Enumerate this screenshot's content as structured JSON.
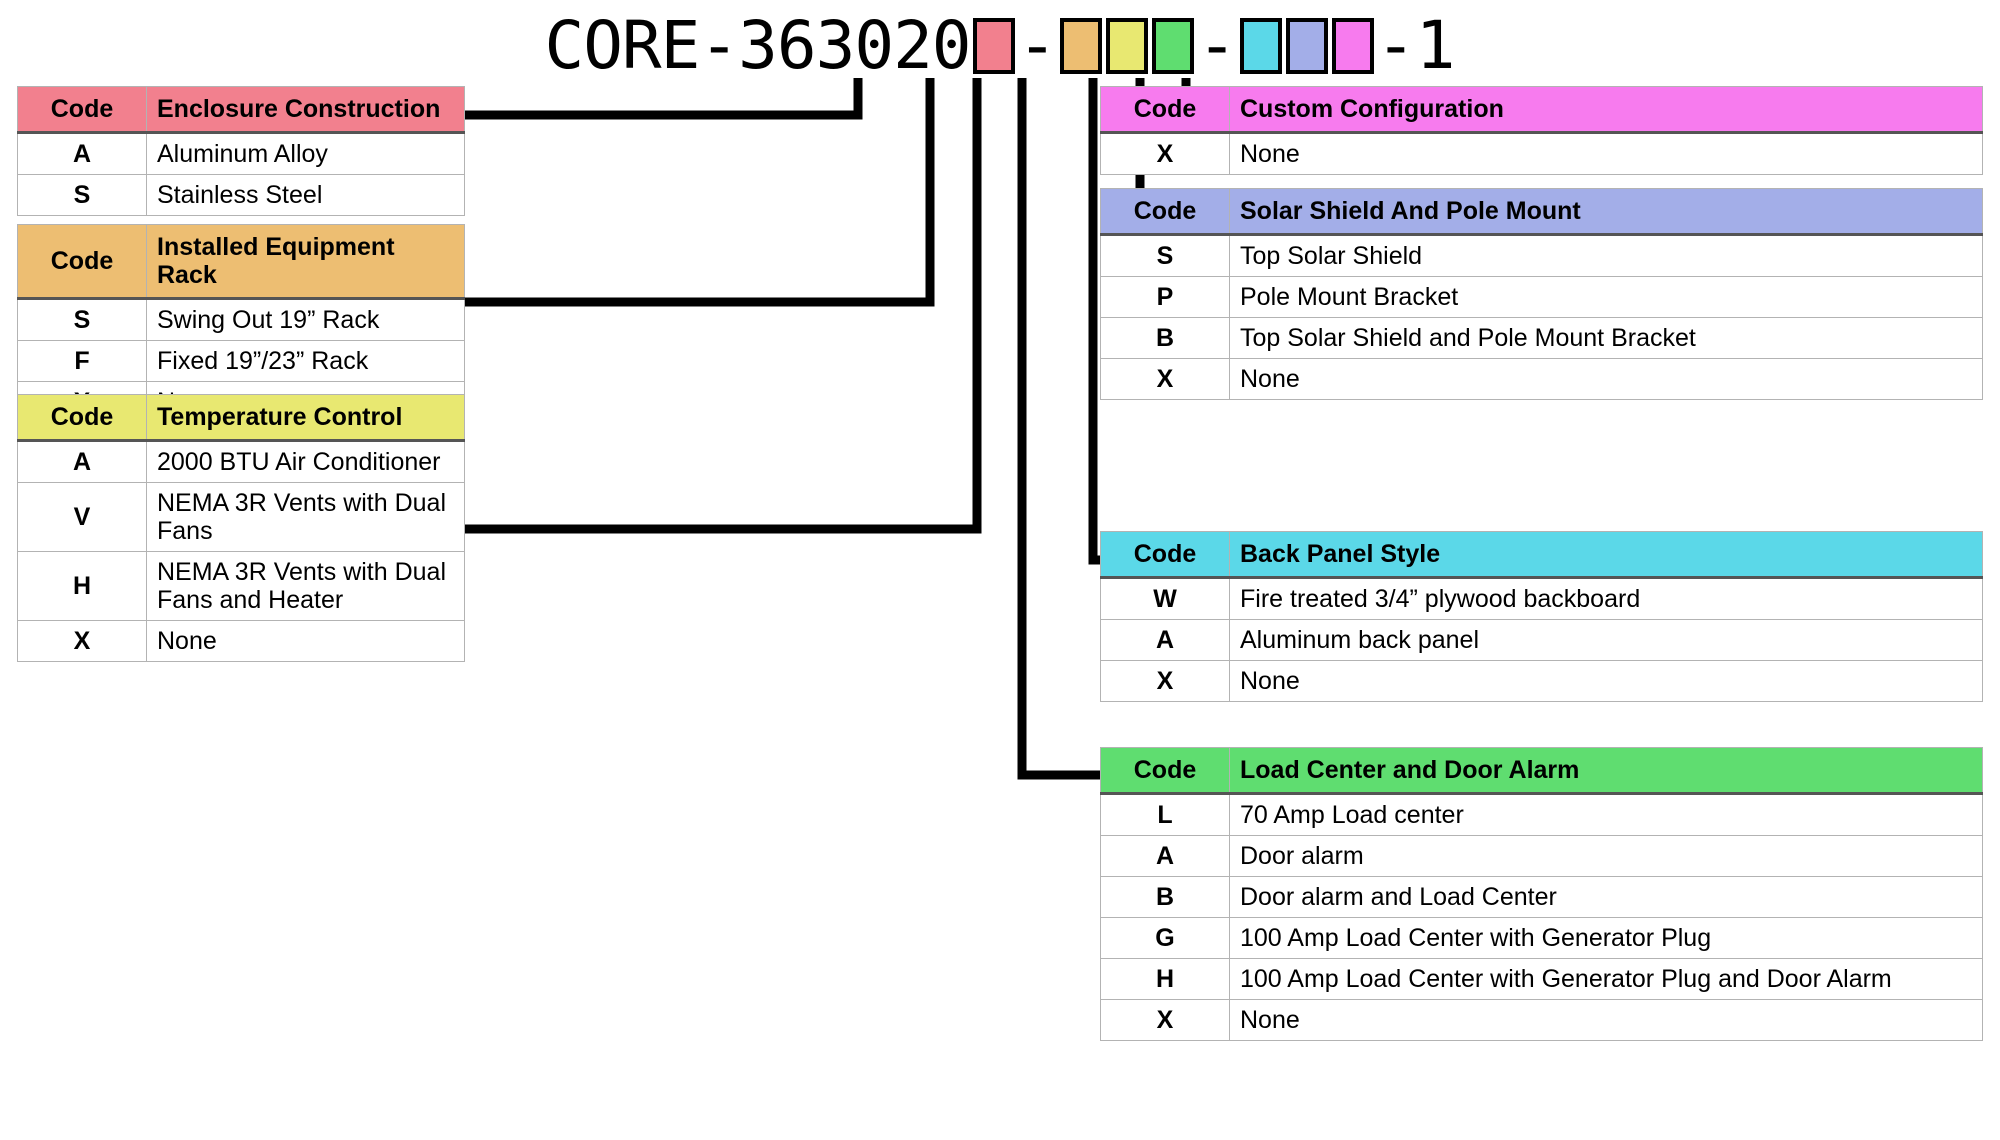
{
  "part_number": {
    "prefix": "CORE-363020",
    "suffix": "-1",
    "dash1": "-",
    "dash2": "-",
    "segments": [
      {
        "name": "enclosure-construction",
        "color": "#F2808E"
      },
      {
        "name": "installed-equipment-rack",
        "color": "#EDBE72"
      },
      {
        "name": "temperature-control",
        "color": "#E8E871"
      },
      {
        "name": "load-center-and-door-alarm",
        "color": "#5FDD70"
      },
      {
        "name": "back-panel-style",
        "color": "#5BD8E8"
      },
      {
        "name": "solar-shield-and-pole-mount",
        "color": "#A3AEE8"
      },
      {
        "name": "custom-configuration",
        "color": "#F77BEE"
      }
    ]
  },
  "code_header": "Code",
  "tables": {
    "enclosure": {
      "title": "Enclosure Construction",
      "color": "#F2808E",
      "rows": [
        {
          "code": "A",
          "desc": "Aluminum Alloy"
        },
        {
          "code": "S",
          "desc": "Stainless Steel"
        }
      ]
    },
    "rack": {
      "title": "Installed Equipment Rack",
      "color": "#EDBE72",
      "rows": [
        {
          "code": "S",
          "desc": "Swing Out 19” Rack"
        },
        {
          "code": "F",
          "desc": "Fixed 19”/23” Rack"
        },
        {
          "code": "X",
          "desc": "None"
        }
      ]
    },
    "temperature": {
      "title": "Temperature Control",
      "color": "#E8E871",
      "rows": [
        {
          "code": "A",
          "desc": "2000 BTU Air Conditioner"
        },
        {
          "code": "V",
          "desc": "NEMA 3R Vents with Dual Fans"
        },
        {
          "code": "H",
          "desc": "NEMA 3R Vents with Dual Fans and Heater"
        },
        {
          "code": "X",
          "desc": "None"
        }
      ]
    },
    "custom": {
      "title": "Custom Configuration",
      "color": "#F77BEE",
      "rows": [
        {
          "code": "X",
          "desc": "None"
        }
      ]
    },
    "solar": {
      "title": "Solar Shield And Pole Mount",
      "color": "#A3AEE8",
      "rows": [
        {
          "code": "S",
          "desc": "Top Solar Shield"
        },
        {
          "code": "P",
          "desc": "Pole Mount Bracket"
        },
        {
          "code": "B",
          "desc": "Top Solar Shield and Pole Mount Bracket"
        },
        {
          "code": "X",
          "desc": "None"
        }
      ]
    },
    "backpanel": {
      "title": "Back Panel Style",
      "color": "#5BD8E8",
      "rows": [
        {
          "code": "W",
          "desc": "Fire treated 3/4” plywood backboard"
        },
        {
          "code": "A",
          "desc": "Aluminum back panel"
        },
        {
          "code": "X",
          "desc": "None"
        }
      ]
    },
    "loadcenter": {
      "title": "Load Center and Door Alarm",
      "color": "#5FDD70",
      "rows": [
        {
          "code": "L",
          "desc": "70 Amp Load center"
        },
        {
          "code": "A",
          "desc": "Door alarm"
        },
        {
          "code": "B",
          "desc": "Door alarm and Load Center"
        },
        {
          "code": "G",
          "desc": "100 Amp Load Center with Generator Plug"
        },
        {
          "code": "H",
          "desc": "100 Amp Load Center with Generator Plug and Door Alarm"
        },
        {
          "code": "X",
          "desc": "None"
        }
      ]
    }
  }
}
